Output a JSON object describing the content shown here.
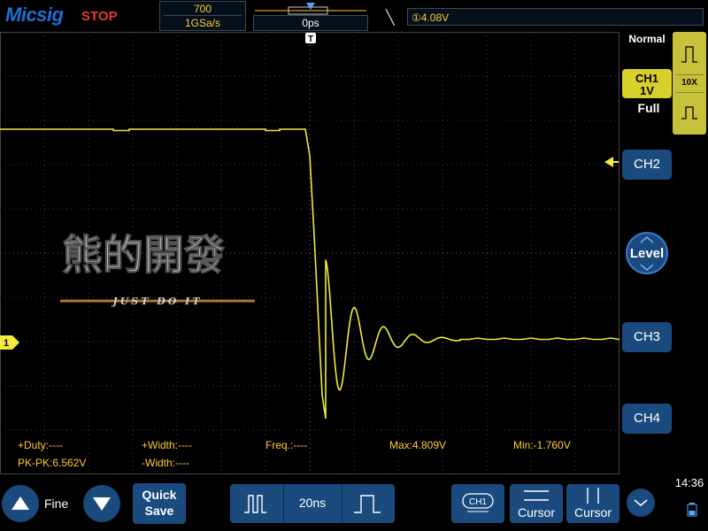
{
  "header": {
    "logo": "Micsig",
    "status": "STOP",
    "memory_depth": "700",
    "sample_rate": "1GSa/s",
    "trigger_position": "0ps",
    "trigger_info": "①4.08V"
  },
  "right_panel": {
    "acq_mode": "Normal",
    "ch1_name": "CH1",
    "ch1_scale": "1V",
    "bandwidth": "Full",
    "probe": "10X",
    "ch2": "CH2",
    "level": "Level",
    "ch3": "CH3",
    "ch4": "CH4"
  },
  "overlay": {
    "watermark_text": "熊的開發",
    "watermark_sub": "JUST DO IT"
  },
  "channel_marker": "1",
  "measurements": {
    "duty": "+Duty:----",
    "width_pos": "+Width:----",
    "freq": "Freq.:----",
    "max": "Max:4.809V",
    "min": "Min:-1.760V",
    "pkpk": "PK-PK:6.562V",
    "width_neg": "-Width:----"
  },
  "bottom": {
    "fine": "Fine",
    "quick_save_line1": "Quick",
    "quick_save_line2": "Save",
    "timebase": "20ns",
    "ch1_badge": "CH1",
    "cursor_h": "Cursor",
    "cursor_v": "Cursor",
    "time": "14:36"
  },
  "colors": {
    "trace": "#f3ea3a",
    "button": "#1b4a7e",
    "measure_text": "#ffcc33",
    "stop": "#e53935"
  }
}
